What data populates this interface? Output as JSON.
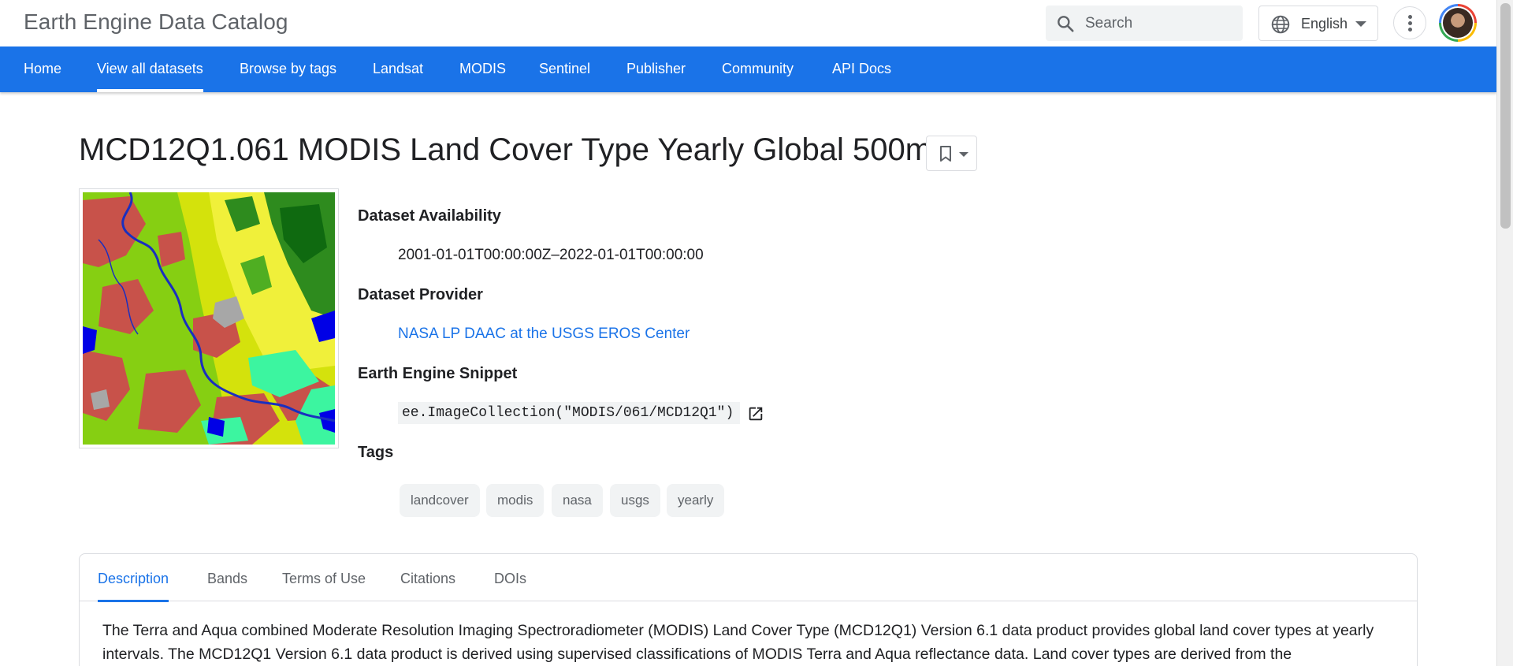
{
  "header": {
    "site_title": "Earth Engine Data Catalog",
    "search_placeholder": "Search",
    "language": "English"
  },
  "nav": {
    "items": [
      {
        "label": "Home",
        "active": false
      },
      {
        "label": "View all datasets",
        "active": true
      },
      {
        "label": "Browse by tags",
        "active": false
      },
      {
        "label": "Landsat",
        "active": false
      },
      {
        "label": "MODIS",
        "active": false
      },
      {
        "label": "Sentinel",
        "active": false
      },
      {
        "label": "Publisher",
        "active": false
      },
      {
        "label": "Community",
        "active": false
      },
      {
        "label": "API Docs",
        "active": false
      }
    ]
  },
  "dataset": {
    "title": "MCD12Q1.061 MODIS Land Cover Type Yearly Global 500m",
    "availability_heading": "Dataset Availability",
    "availability_value": "2001-01-01T00:00:00Z–2022-01-01T00:00:00",
    "provider_heading": "Dataset Provider",
    "provider_link": "NASA LP DAAC at the USGS EROS Center",
    "snippet_heading": "Earth Engine Snippet",
    "snippet_code": "ee.ImageCollection(\"MODIS/061/MCD12Q1\")",
    "tags_heading": "Tags",
    "tags": [
      "landcover",
      "modis",
      "nasa",
      "usgs",
      "yearly"
    ]
  },
  "tabs": {
    "items": [
      "Description",
      "Bands",
      "Terms of Use",
      "Citations",
      "DOIs"
    ],
    "active": "Description"
  },
  "description": {
    "text": "The Terra and Aqua combined Moderate Resolution Imaging Spectroradiometer (MODIS) Land Cover Type (MCD12Q1) Version 6.1 data product provides global land cover types at yearly intervals. The MCD12Q1 Version 6.1 data product is derived using supervised classifications of MODIS Terra and Aqua reflectance data. Land cover types are derived from the"
  },
  "icons": {
    "search": "search-icon",
    "language": "globe-icon",
    "more": "more-vert-icon",
    "bookmark": "bookmark-icon",
    "open": "open-in-new-icon"
  },
  "colors": {
    "brand_blue": "#1a73e8",
    "link": "#1a73e8",
    "chip_bg": "#f1f3f4"
  }
}
